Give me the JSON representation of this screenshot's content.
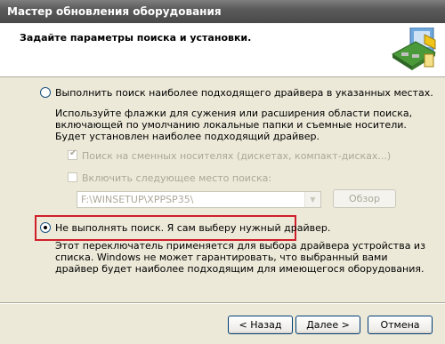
{
  "window": {
    "title": "Мастер обновления оборудования"
  },
  "header": {
    "title": "Задайте параметры поиска и установки.",
    "icon": "hardware-wizard-icon"
  },
  "option_search": {
    "label": "Выполнить поиск наиболее подходящего драйвера в указанных местах.",
    "selected": false,
    "description": "Используйте флажки для сужения или расширения области поиска, включающей по умолчанию локальные папки и съемные носители. Будет установлен наиболее подходящий драйвер.",
    "search_removable_label": "Поиск на сменных носителях (дискетах, компакт-дисках...)",
    "search_removable_checked": true,
    "include_location_label": "Включить следующее место поиска:",
    "include_location_checked": false,
    "location_value": "F:\\WINSETUP\\XPPSP35\\",
    "browse_label": "Обзор"
  },
  "option_manual": {
    "label": "Не выполнять поиск. Я сам выберу нужный драйвер.",
    "selected": true,
    "description": "Этот переключатель применяется для выбора драйвера устройства из списка. Windows не может гарантировать, что выбранный вами драйвер будет наиболее подходящим для имеющегося оборудования."
  },
  "footer": {
    "back_label": "< Назад",
    "next_label": "Далее >",
    "cancel_label": "Отмена"
  },
  "colors": {
    "highlight_border": "#d01f2a",
    "dialog_bg": "#ece9d8"
  }
}
